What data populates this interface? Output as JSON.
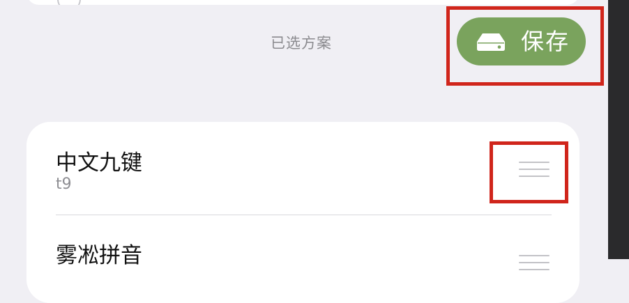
{
  "top_item": {
    "title": "radical_pinyin"
  },
  "section": {
    "label": "已选方案"
  },
  "toolbar": {
    "save_label": "保存",
    "save_icon": "drive-icon",
    "save_color": "#7aa35d"
  },
  "schemes": [
    {
      "title": "中文九键",
      "id": "t9"
    },
    {
      "title": "雾凇拼音",
      "id": ""
    }
  ],
  "highlight_color": "#d0251b"
}
